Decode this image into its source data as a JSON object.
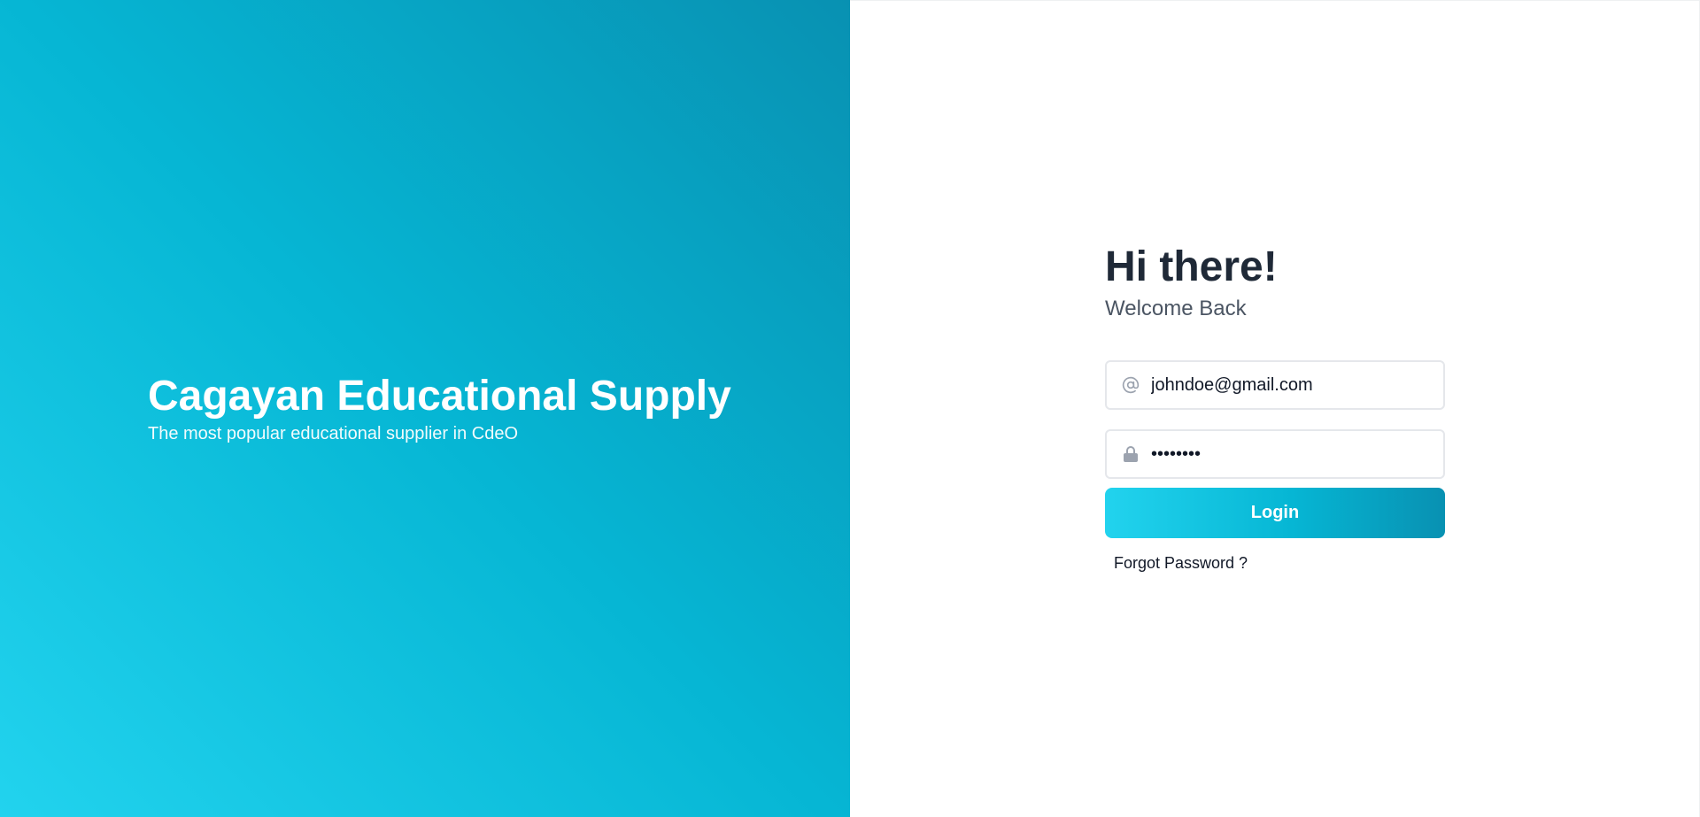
{
  "hero": {
    "title": "Cagayan Educational Supply",
    "subtitle": "The most popular educational supplier in CdeO",
    "gradient_colors": [
      "#22d3ee",
      "#06b6d4",
      "#0891b2"
    ]
  },
  "login": {
    "greeting": "Hi there!",
    "welcome": "Welcome Back",
    "email": {
      "value": "johndoe@gmail.com",
      "icon": "at-icon"
    },
    "password": {
      "value": "password",
      "icon": "lock-icon"
    },
    "login_label": "Login",
    "forgot_label": "Forgot Password ?"
  },
  "colors": {
    "accent": "#06b6d4",
    "heading": "#1f2937",
    "muted": "#4b5563",
    "icon": "#9ca3af"
  }
}
